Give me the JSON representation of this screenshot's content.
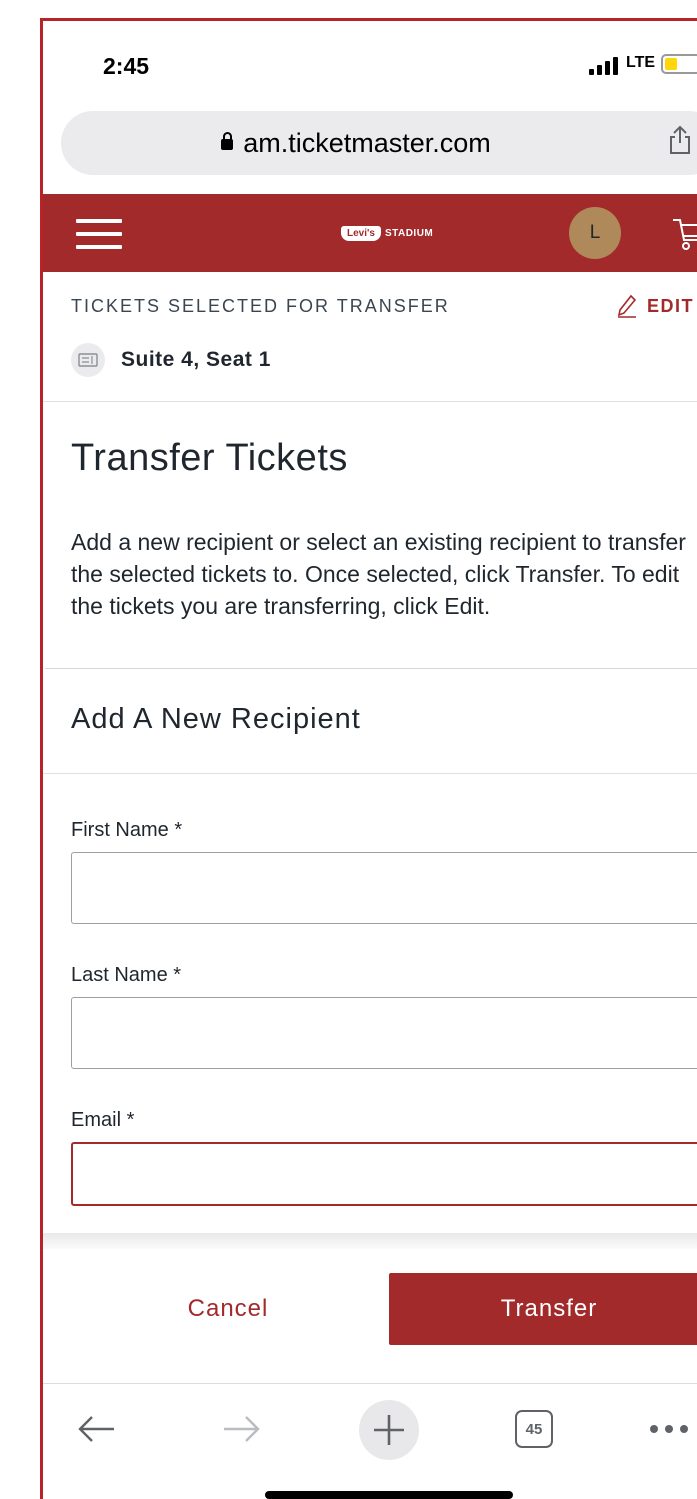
{
  "status_bar": {
    "time": "2:45",
    "network": "LTE"
  },
  "browser": {
    "url": "am.ticketmaster.com",
    "tab_count": "45"
  },
  "header": {
    "logo_brand": "Levi's",
    "logo_suffix": "STADIUM",
    "avatar_initial": "L",
    "brand_color": "#a32a2b"
  },
  "selection": {
    "label": "TICKETS SELECTED FOR TRANSFER",
    "edit_label": "EDIT",
    "seat": "Suite 4, Seat 1"
  },
  "transfer": {
    "title": "Transfer Tickets",
    "description": "Add a new recipient or select an existing recipient to transfer the selected tickets to. Once selected, click Transfer. To edit the tickets you are transferring, click Edit."
  },
  "recipient_form": {
    "title": "Add A New Recipient",
    "first_name_label": "First Name *",
    "first_name_value": "",
    "last_name_label": "Last Name *",
    "last_name_value": "",
    "email_label": "Email *",
    "email_value": ""
  },
  "actions": {
    "cancel_label": "Cancel",
    "transfer_label": "Transfer"
  }
}
